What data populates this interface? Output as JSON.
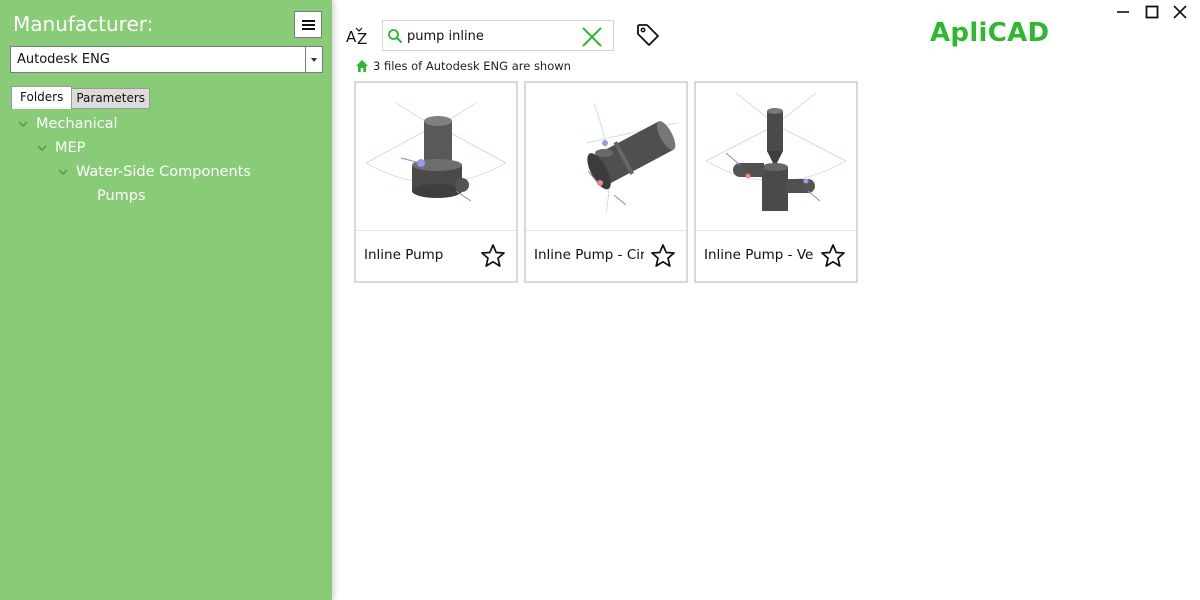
{
  "sidebar": {
    "manufacturer_label": "Manufacturer:",
    "manufacturer_value": "Autodesk ENG",
    "tabs": [
      {
        "label": "Folders",
        "active": true
      },
      {
        "label": "Parameters",
        "active": false
      }
    ],
    "tree": [
      {
        "label": "Mechanical",
        "level": 0,
        "expanded": true
      },
      {
        "label": "MEP",
        "level": 1,
        "expanded": true
      },
      {
        "label": "Water-Side Components",
        "level": 2,
        "expanded": true
      },
      {
        "label": "Pumps",
        "level": 3,
        "expanded": false
      }
    ]
  },
  "toolbar": {
    "search_value": "pump inline",
    "logo": "ApliCAD"
  },
  "status": {
    "text": "3 files of Autodesk ENG are shown"
  },
  "cards": [
    {
      "label": "Inline Pump",
      "icon": "pump-vertical-thumbnail",
      "favorite": false
    },
    {
      "label": "Inline Pump - Circular",
      "icon": "pump-circular-thumbnail",
      "favorite": false
    },
    {
      "label": "Inline Pump - Vertical",
      "icon": "pump-vertical-inline-thumbnail",
      "favorite": false
    }
  ],
  "colors": {
    "sidebar_bg": "#88cc77",
    "accent_green": "#2db92d"
  }
}
